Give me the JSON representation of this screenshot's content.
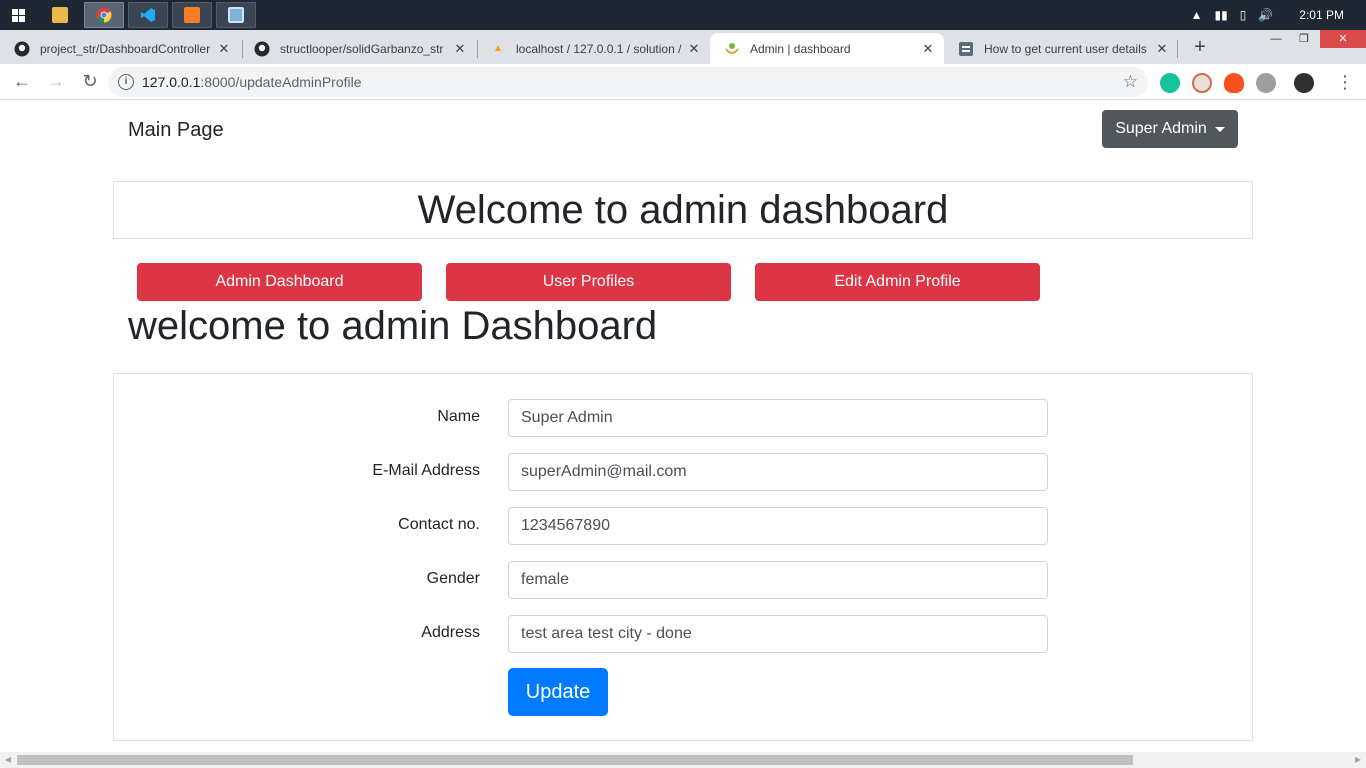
{
  "taskbar": {
    "clock": "2:01 PM",
    "apps": [
      "file-explorer",
      "chrome",
      "vscode",
      "xampp",
      "window-app"
    ]
  },
  "browser": {
    "tabs": [
      {
        "title": "project_str/DashboardController",
        "icon": "github-icon"
      },
      {
        "title": "structlooper/solidGarbanzo_str",
        "icon": "github-icon"
      },
      {
        "title": "localhost / 127.0.0.1 / solution /",
        "icon": "phpmyadmin-icon"
      },
      {
        "title": "Admin | dashboard",
        "icon": "site-logo-icon"
      },
      {
        "title": "How to get current user details",
        "icon": "stackoverflow-icon"
      }
    ],
    "url_host": "127.0.0.1",
    "url_rest": ":8000/updateAdminProfile"
  },
  "navbar": {
    "brand": "Main Page",
    "user_menu": "Super Admin"
  },
  "hero": {
    "title": "Welcome to admin dashboard"
  },
  "nav_buttons": {
    "dashboard": "Admin Dashboard",
    "profiles": "User Profiles",
    "edit": "Edit Admin Profile"
  },
  "subheading": "welcome to admin Dashboard",
  "form": {
    "fields": [
      {
        "label": "Name",
        "value": "Super Admin"
      },
      {
        "label": "E-Mail Address",
        "value": "superAdmin@mail.com"
      },
      {
        "label": "Contact no.",
        "value": "1234567890"
      },
      {
        "label": "Gender",
        "value": "female"
      },
      {
        "label": "Address",
        "value": "test area test city - done"
      }
    ],
    "submit": "Update"
  },
  "colors": {
    "danger": "#dc3545",
    "primary": "#007bff",
    "secondary": "#52575c"
  }
}
